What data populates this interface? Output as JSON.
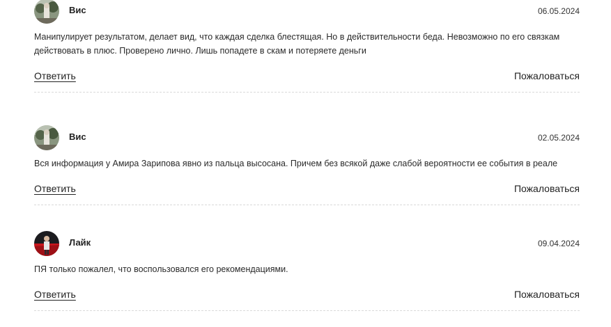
{
  "comments": [
    {
      "author": "Вис",
      "date": "06.05.2024",
      "avatar_icon": "user-photo-icon",
      "text": "Манипулирует результатом, делает вид, что каждая сделка блестящая. Но в действительности беда. Невозможно по его связкам действовать в плюс. Проверено лично. Лишь попадете в скам и потеряете деньги",
      "reply_label": "Ответить",
      "report_label": "Пожаловаться"
    },
    {
      "author": "Вис",
      "date": "02.05.2024",
      "avatar_icon": "user-photo-icon",
      "text": "Вся информация у Амира Зарипова явно из пальца высосана. Причем без всякой даже слабой вероятности ее события в реале",
      "reply_label": "Ответить",
      "report_label": "Пожаловаться"
    },
    {
      "author": "Лайк",
      "date": "09.04.2024",
      "avatar_icon": "user-photo-icon",
      "text": "ПЯ только пожалел, что воспользовался его рекомендациями.",
      "reply_label": "Ответить",
      "report_label": "Пожаловаться"
    }
  ],
  "colors": {
    "text": "#222222",
    "divider": "#d9d9d9",
    "avatar_red": "#c8161d"
  }
}
